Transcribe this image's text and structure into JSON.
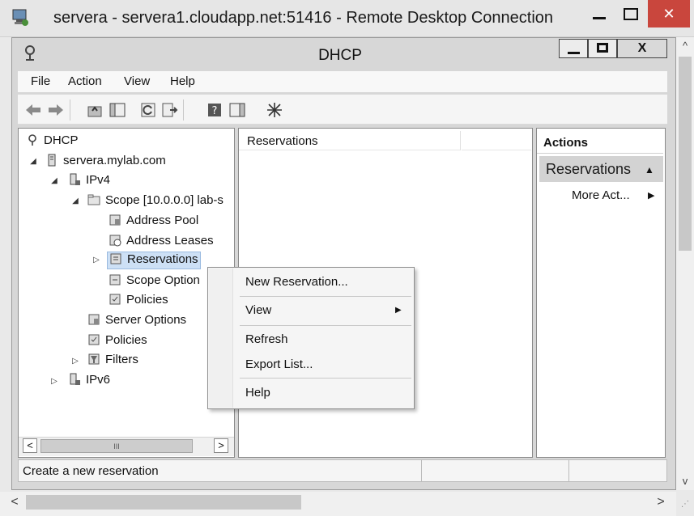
{
  "rdp": {
    "title": "servera - servera1.cloudapp.net:51416 - Remote Desktop Connection",
    "close_label": "✕"
  },
  "dhcp_window": {
    "title": "DHCP",
    "close_label": "X"
  },
  "menubar": {
    "items": [
      "File",
      "Action",
      "View",
      "Help"
    ]
  },
  "tree": {
    "items": [
      {
        "label": "DHCP",
        "icon": "dhcp-icon"
      },
      {
        "label": "servera.mylab.com",
        "icon": "server-icon"
      },
      {
        "label": "IPv4",
        "icon": "ipv4-icon"
      },
      {
        "label": "Scope [10.0.0.0] lab-s",
        "icon": "folder-icon"
      },
      {
        "label": "Address Pool",
        "icon": "address-pool-icon"
      },
      {
        "label": "Address Leases",
        "icon": "address-leases-icon"
      },
      {
        "label": "Reservations",
        "icon": "reservations-icon"
      },
      {
        "label": "Scope Option",
        "icon": "scope-options-icon"
      },
      {
        "label": "Policies",
        "icon": "policies-icon"
      },
      {
        "label": "Server Options",
        "icon": "server-options-icon"
      },
      {
        "label": "Policies",
        "icon": "policies-icon"
      },
      {
        "label": "Filters",
        "icon": "filters-icon"
      },
      {
        "label": "IPv6",
        "icon": "ipv6-icon"
      }
    ],
    "scroll_thumb_glyph": "III"
  },
  "center": {
    "column_header": "Reservations"
  },
  "actions": {
    "title": "Actions",
    "section": "Reservations",
    "more": "More Act..."
  },
  "context_menu": {
    "items": [
      "New Reservation...",
      "View",
      "Refresh",
      "Export List...",
      "Help"
    ]
  },
  "status": {
    "text": "Create a new reservation"
  },
  "colors": {
    "close_red": "#c9463d",
    "selected_bg": "#cde0f5",
    "actions_section_bg": "#d3d3d3"
  }
}
